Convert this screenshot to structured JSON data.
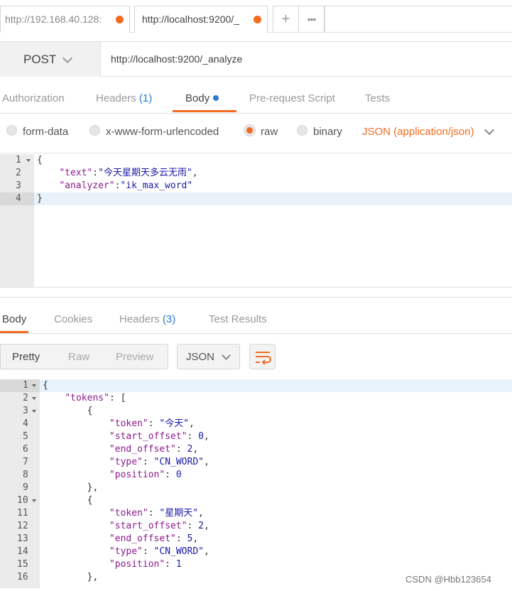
{
  "tabs": [
    {
      "label": "http://192.168.40.128:",
      "active": false
    },
    {
      "label": "http://localhost:9200/_",
      "active": true
    }
  ],
  "tab_actions": {
    "new": "+",
    "more": "•••"
  },
  "request": {
    "method": "POST",
    "url": "http://localhost:9200/_analyze"
  },
  "request_tabs": {
    "authorization": "Authorization",
    "headers": "Headers",
    "headers_count": "(1)",
    "body": "Body",
    "prerequest": "Pre-request Script",
    "tests": "Tests"
  },
  "body_types": {
    "form_data": "form-data",
    "urlencoded": "x-www-form-urlencoded",
    "raw": "raw",
    "binary": "binary",
    "selected": "raw",
    "content_type": "JSON (application/json)"
  },
  "request_body": {
    "line_numbers": [
      "1",
      "2",
      "3",
      "4"
    ],
    "text_value": "今天星期天多云无雨",
    "analyzer_value": "ik_max_word"
  },
  "response_tabs": {
    "body": "Body",
    "cookies": "Cookies",
    "headers": "Headers",
    "headers_count": "(3)",
    "test_results": "Test Results"
  },
  "response_view": {
    "pretty": "Pretty",
    "raw": "Raw",
    "preview": "Preview",
    "format": "JSON"
  },
  "response_body": {
    "line_numbers": [
      "1",
      "2",
      "3",
      "4",
      "5",
      "6",
      "7",
      "8",
      "9",
      "10",
      "11",
      "12",
      "13",
      "14",
      "15",
      "16"
    ],
    "tokens": [
      {
        "token": "今天",
        "start_offset": "0",
        "end_offset": "2",
        "type": "CN_WORD",
        "position": "0"
      },
      {
        "token": "星期天",
        "start_offset": "2",
        "end_offset": "5",
        "type": "CN_WORD",
        "position": "1"
      }
    ]
  },
  "watermark": "CSDN @Hbb123654",
  "colors": {
    "accent": "#f26b21",
    "link_blue": "#2a7ad4",
    "string_blue": "#1a1aa6",
    "key_purple": "#8b1a8b"
  }
}
